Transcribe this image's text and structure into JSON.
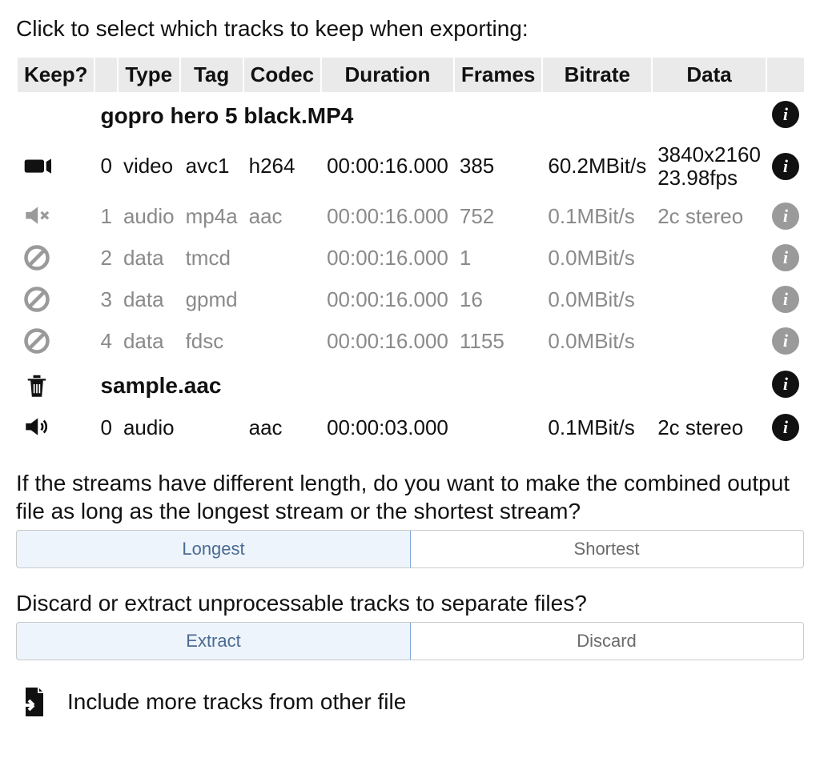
{
  "instruction": "Click to select which tracks to keep when exporting:",
  "columns": {
    "keep": "Keep?",
    "type": "Type",
    "tag": "Tag",
    "codec": "Codec",
    "duration": "Duration",
    "frames": "Frames",
    "bitrate": "Bitrate",
    "data": "Data"
  },
  "files": [
    {
      "name": "gopro hero 5 black.MP4",
      "header_icon": "",
      "tracks": [
        {
          "icon": "video",
          "active": true,
          "idx": "0",
          "type": "video",
          "tag": "avc1",
          "codec": "h264",
          "duration": "00:00:16.000",
          "frames": "385",
          "bitrate": "60.2MBit/s",
          "data1": "3840x2160",
          "data2": "23.98fps"
        },
        {
          "icon": "muted",
          "active": false,
          "idx": "1",
          "type": "audio",
          "tag": "mp4a",
          "codec": "aac",
          "duration": "00:00:16.000",
          "frames": "752",
          "bitrate": "0.1MBit/s",
          "data1": "2c stereo",
          "data2": ""
        },
        {
          "icon": "ban",
          "active": false,
          "idx": "2",
          "type": "data",
          "tag": "tmcd",
          "codec": "",
          "duration": "00:00:16.000",
          "frames": "1",
          "bitrate": "0.0MBit/s",
          "data1": "",
          "data2": ""
        },
        {
          "icon": "ban",
          "active": false,
          "idx": "3",
          "type": "data",
          "tag": "gpmd",
          "codec": "",
          "duration": "00:00:16.000",
          "frames": "16",
          "bitrate": "0.0MBit/s",
          "data1": "",
          "data2": ""
        },
        {
          "icon": "ban",
          "active": false,
          "idx": "4",
          "type": "data",
          "tag": "fdsc",
          "codec": "",
          "duration": "00:00:16.000",
          "frames": "1155",
          "bitrate": "0.0MBit/s",
          "data1": "",
          "data2": ""
        }
      ]
    },
    {
      "name": "sample.aac",
      "header_icon": "trash",
      "tracks": [
        {
          "icon": "audio",
          "active": true,
          "idx": "0",
          "type": "audio",
          "tag": "",
          "codec": "aac",
          "duration": "00:00:03.000",
          "frames": "",
          "bitrate": "0.1MBit/s",
          "data1": "2c stereo",
          "data2": ""
        }
      ]
    }
  ],
  "length_question": "If the streams have different length, do you want to make the combined output file as long as the longest stream or the shortest stream?",
  "length_options": {
    "longest": "Longest",
    "shortest": "Shortest"
  },
  "discard_question": "Discard or extract unprocessable tracks to separate files?",
  "discard_options": {
    "extract": "Extract",
    "discard": "Discard"
  },
  "include_more": "Include more tracks from other file"
}
